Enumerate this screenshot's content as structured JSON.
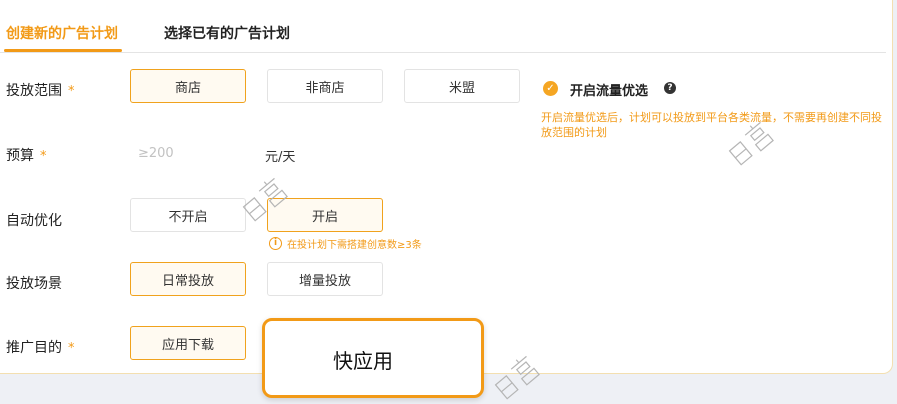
{
  "tabs": {
    "create_new": "创建新的广告计划",
    "choose_existing": "选择已有的广告计划"
  },
  "placement_range": {
    "label": "投放范围",
    "required": "*",
    "options": [
      "商店",
      "非商店",
      "米盟"
    ],
    "selected": "商店"
  },
  "flow_optimization": {
    "label": "开启流量优选",
    "checked": true,
    "description": "开启流量优选后，计划可以投放到平台各类流量，不需要再创建不同投放范围的计划"
  },
  "budget": {
    "label": "预算",
    "required": "*",
    "placeholder": "≥200",
    "unit": "元/天"
  },
  "auto_optimize": {
    "label": "自动优化",
    "options": [
      "不开启",
      "开启"
    ],
    "selected": "开启",
    "tip": "在投计划下需搭建创意数≥3条"
  },
  "scene": {
    "label": "投放场景",
    "options": [
      "日常投放",
      "增量投放"
    ],
    "selected": "日常投放"
  },
  "purpose": {
    "label": "推广目的",
    "required": "*",
    "options": [
      "应用下载"
    ],
    "selected": "应用下载",
    "popup_option": "快应用"
  },
  "colors": {
    "accent": "#f29a17",
    "selected_border": "#f0a21d"
  },
  "watermark": "巨量"
}
